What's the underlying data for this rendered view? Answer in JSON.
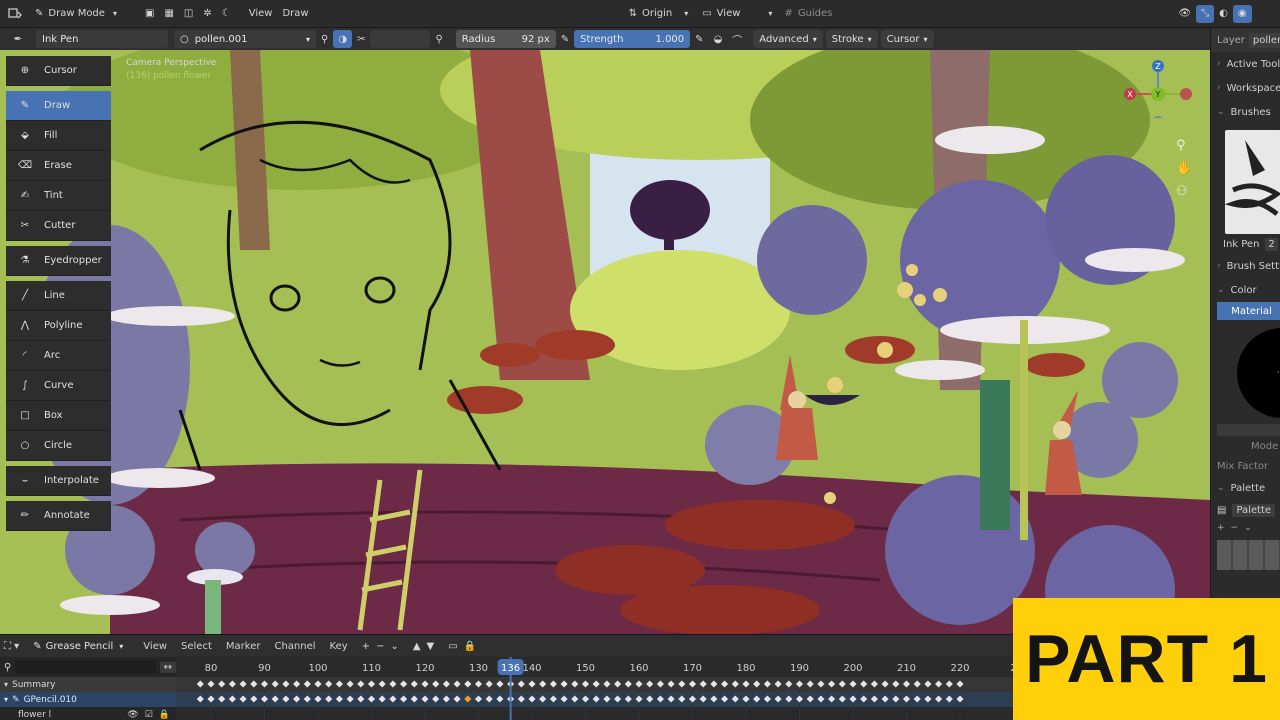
{
  "topbar": {
    "mode": "Draw Mode",
    "menu_view": "View",
    "menu_draw": "Draw",
    "origin": "Origin",
    "view": "View",
    "guides": "Guides"
  },
  "toolheader": {
    "brush_name": "Ink Pen",
    "material": "pollen.001",
    "radius_label": "Radius",
    "radius_value": "92 px",
    "strength_label": "Strength",
    "strength_value": "1.000",
    "advanced": "Advanced",
    "stroke": "Stroke",
    "cursor": "Cursor"
  },
  "tools": [
    {
      "label": "Cursor",
      "icon": "cursor-icon"
    },
    {
      "label": "Draw",
      "icon": "draw-icon"
    },
    {
      "label": "Fill",
      "icon": "fill-icon"
    },
    {
      "label": "Erase",
      "icon": "erase-icon"
    },
    {
      "label": "Tint",
      "icon": "tint-icon"
    },
    {
      "label": "Cutter",
      "icon": "cutter-icon"
    },
    {
      "label": "Eyedropper",
      "icon": "eyedropper-icon"
    },
    {
      "label": "Line",
      "icon": "line-icon"
    },
    {
      "label": "Polyline",
      "icon": "polyline-icon"
    },
    {
      "label": "Arc",
      "icon": "arc-icon"
    },
    {
      "label": "Curve",
      "icon": "curve-icon"
    },
    {
      "label": "Box",
      "icon": "box-icon"
    },
    {
      "label": "Circle",
      "icon": "circle-icon"
    },
    {
      "label": "Interpolate",
      "icon": "interpolate-icon"
    },
    {
      "label": "Annotate",
      "icon": "annotate-icon"
    }
  ],
  "viewport": {
    "perspective": "Camera Perspective",
    "object_info": "(136) pollen flower"
  },
  "gizmo": {
    "z": "Z",
    "x": "X",
    "y": "Y"
  },
  "right_panel": {
    "layer_label": "Layer",
    "layer_value": "pollen",
    "active_tool": "Active Tool",
    "workspace": "Workspace",
    "brushes": "Brushes",
    "brush_name": "Ink Pen",
    "brush_count": "2",
    "brush_settings": "Brush Settings",
    "color": "Color",
    "material_tab": "Material",
    "mode": "Mode",
    "mix_factor": "Mix Factor",
    "palette": "Palette",
    "palette_field": "Palette"
  },
  "timeline": {
    "editor": "Grease Pencil",
    "menus": [
      "View",
      "Select",
      "Marker",
      "Channel",
      "Key"
    ],
    "frame_ticks": [
      "80",
      "90",
      "100",
      "110",
      "120",
      "130",
      "140",
      "150",
      "160",
      "170",
      "180",
      "190",
      "200",
      "210",
      "220",
      "2"
    ],
    "current_frame": "136",
    "channels": [
      "Summary",
      "GPencil.010",
      "flower l"
    ]
  },
  "overlay_banner": "PART 1",
  "colors": {
    "accent": "#4772b3",
    "banner": "#ffcf0a",
    "playhead": "#4772b3"
  }
}
